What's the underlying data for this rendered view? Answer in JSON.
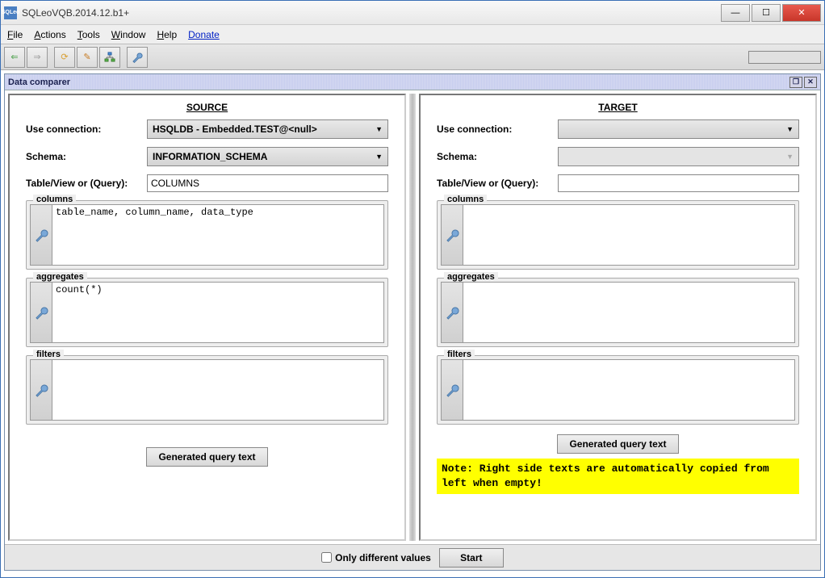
{
  "window": {
    "title": "SQLeoVQB.2014.12.b1+",
    "appIconText": "SQLeo"
  },
  "menu": {
    "file": "File",
    "actions": "Actions",
    "tools": "Tools",
    "window": "Window",
    "help": "Help",
    "donate": "Donate"
  },
  "subwindow": {
    "title": "Data comparer"
  },
  "panes": {
    "source": {
      "header": "SOURCE",
      "connectionLabel": "Use connection:",
      "connectionValue": "HSQLDB - Embedded.TEST@<null>",
      "schemaLabel": "Schema:",
      "schemaValue": "INFORMATION_SCHEMA",
      "tableLabel": "Table/View or (Query):",
      "tableValue": "COLUMNS",
      "columnsLegend": "columns",
      "columnsText": "table_name, column_name, data_type",
      "aggregatesLegend": "aggregates",
      "aggregatesText": "count(*)",
      "filtersLegend": "filters",
      "filtersText": "",
      "genButton": "Generated query text"
    },
    "target": {
      "header": "TARGET",
      "connectionLabel": "Use connection:",
      "connectionValue": "",
      "schemaLabel": "Schema:",
      "schemaValue": "",
      "tableLabel": "Table/View or (Query):",
      "tableValue": "",
      "columnsLegend": "columns",
      "columnsText": "",
      "aggregatesLegend": "aggregates",
      "aggregatesText": "",
      "filtersLegend": "filters",
      "filtersText": "",
      "genButton": "Generated query text",
      "note": "Note: Right side texts are automatically copied from left when empty!"
    }
  },
  "bottom": {
    "checkboxLabel": "Only different values",
    "startButton": "Start"
  }
}
